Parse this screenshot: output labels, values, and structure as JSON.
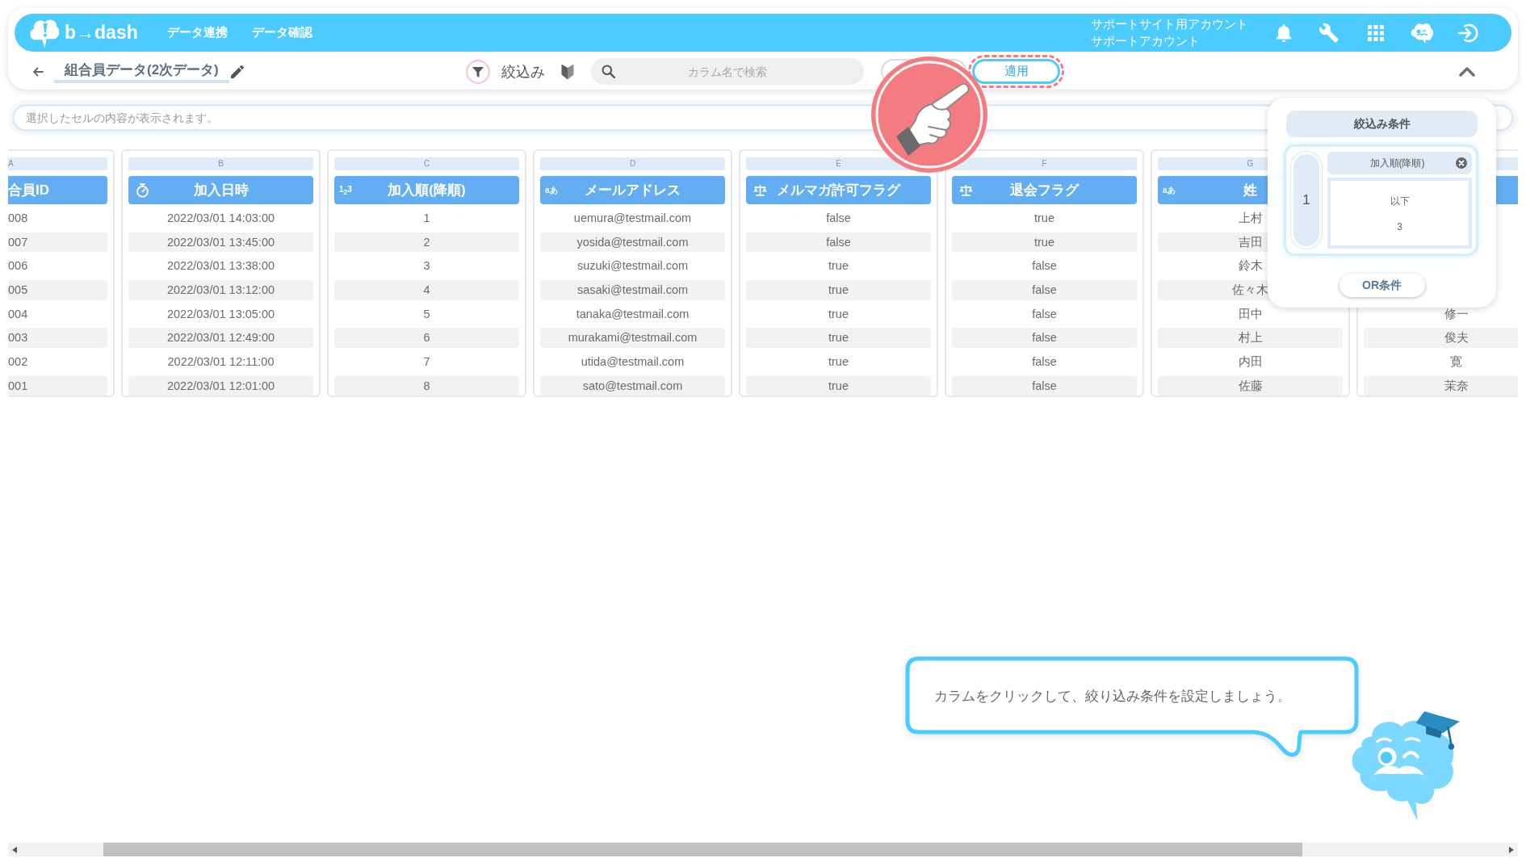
{
  "header": {
    "logo_text": "b→dash",
    "nav": [
      {
        "label": "データ連携"
      },
      {
        "label": "データ確認"
      }
    ],
    "account": {
      "organization": "サポートサイト用アカウント",
      "user": "サポートアカウント"
    }
  },
  "toolbar": {
    "title": "組合員データ(2次データ)",
    "filter_label": "絞込み",
    "search": {
      "placeholder": "カラム名で検索"
    },
    "apply_button": "適用",
    "apply_highlighted": true
  },
  "cell_preview": {
    "placeholder": "選択したセルの内容が表示されます。"
  },
  "table": {
    "columns": [
      {
        "letter": "A",
        "title": "合員ID",
        "cells": [
          "008",
          "007",
          "006",
          "005",
          "004",
          "003",
          "002",
          "001"
        ]
      },
      {
        "letter": "B",
        "kind": "datetime",
        "title": "加入日時",
        "cells": [
          "2022/03/01 14:03:00",
          "2022/03/01 13:45:00",
          "2022/03/01 13:38:00",
          "2022/03/01 13:12:00",
          "2022/03/01 13:05:00",
          "2022/03/01 12:49:00",
          "2022/03/01 12:11:00",
          "2022/03/01 12:01:00"
        ]
      },
      {
        "letter": "C",
        "kind": "number",
        "type_mark": "1$_{2}$3",
        "title": "加入順(降順)",
        "cells": [
          "1",
          "2",
          "3",
          "4",
          "5",
          "6",
          "7",
          "8"
        ]
      },
      {
        "letter": "D",
        "kind": "text",
        "type_mark": "aあ",
        "title": "メールアドレス",
        "cells": [
          "uemura@testmail.com",
          "yosida@testmail.com",
          "suzuki@testmail.com",
          "sasaki@testmail.com",
          "tanaka@testmail.com",
          "murakami@testmail.com",
          "utida@testmail.com",
          "sato@testmail.com"
        ]
      },
      {
        "letter": "E",
        "kind": "boolean",
        "title": "メルマガ許可フラグ",
        "cells": [
          "false",
          "false",
          "true",
          "true",
          "true",
          "true",
          "true",
          "true"
        ]
      },
      {
        "letter": "F",
        "kind": "boolean",
        "title": "退会フラグ",
        "cells": [
          "true",
          "true",
          "false",
          "false",
          "false",
          "false",
          "false",
          "false"
        ]
      },
      {
        "letter": "G",
        "kind": "text",
        "type_mark": "aあ",
        "title": "姓",
        "cells": [
          "上村",
          "吉田",
          "鈴木",
          "佐々木",
          "田中",
          "村上",
          "内田",
          "佐藤"
        ]
      },
      {
        "cells": [
          "修一",
          "俊夫",
          "寛",
          "茉奈"
        ]
      }
    ]
  },
  "filter_panel": {
    "title": "絞込み条件",
    "groups": [
      {
        "number": "1",
        "conditions": [
          {
            "column": "加入順(降順)",
            "operator": "以下",
            "value": "3"
          }
        ]
      }
    ],
    "or_button": "OR条件"
  },
  "hint": {
    "text": "カラムをクリックして、絞り込み条件を設定しましょう。"
  }
}
